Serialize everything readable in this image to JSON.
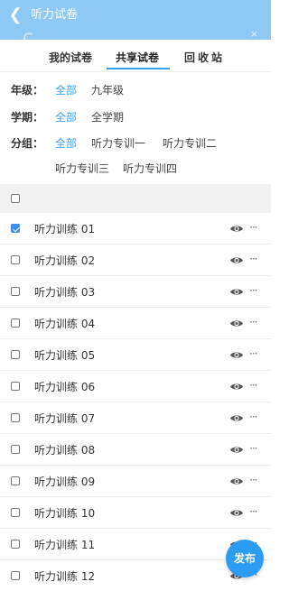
{
  "header": {
    "title": "听力试卷",
    "back_icon": "back-chevron-icon",
    "close_glyph": "×"
  },
  "tabs": [
    {
      "label": "我的试卷"
    },
    {
      "label": "共享试卷",
      "active": true
    },
    {
      "label": "回收站"
    }
  ],
  "filters": {
    "grade": {
      "label": "年级：",
      "options": [
        "全部",
        "九年级"
      ],
      "selected": "全部"
    },
    "term": {
      "label": "学期：",
      "options": [
        "全部",
        "全学期"
      ],
      "selected": "全部"
    },
    "group": {
      "label": "分组：",
      "options": [
        "全部",
        "听力专训一",
        "听力专训二",
        "听力专训三",
        "听力专训四"
      ],
      "selected": "全部"
    }
  },
  "list": {
    "items": [
      {
        "title": "听力训练 01",
        "checked": true
      },
      {
        "title": "听力训练 02",
        "checked": false
      },
      {
        "title": "听力训练 03",
        "checked": false
      },
      {
        "title": "听力训练 04",
        "checked": false
      },
      {
        "title": "听力训练 05",
        "checked": false
      },
      {
        "title": "听力训练 06",
        "checked": false
      },
      {
        "title": "听力训练 07",
        "checked": false
      },
      {
        "title": "听力训练 08",
        "checked": false
      },
      {
        "title": "听力训练 09",
        "checked": false
      },
      {
        "title": "听力训练 10",
        "checked": false
      },
      {
        "title": "听力训练 11",
        "checked": false
      },
      {
        "title": "听力训练 12",
        "checked": false
      }
    ],
    "row_icons": [
      "eye-icon",
      "more-icon"
    ]
  },
  "fab": {
    "label": "发布"
  },
  "colors": {
    "header_bg": "#8ec9f5",
    "accent": "#3aa3f2",
    "fab": "#2c9cf3",
    "checkbox_checked": "#3b8fe6"
  }
}
